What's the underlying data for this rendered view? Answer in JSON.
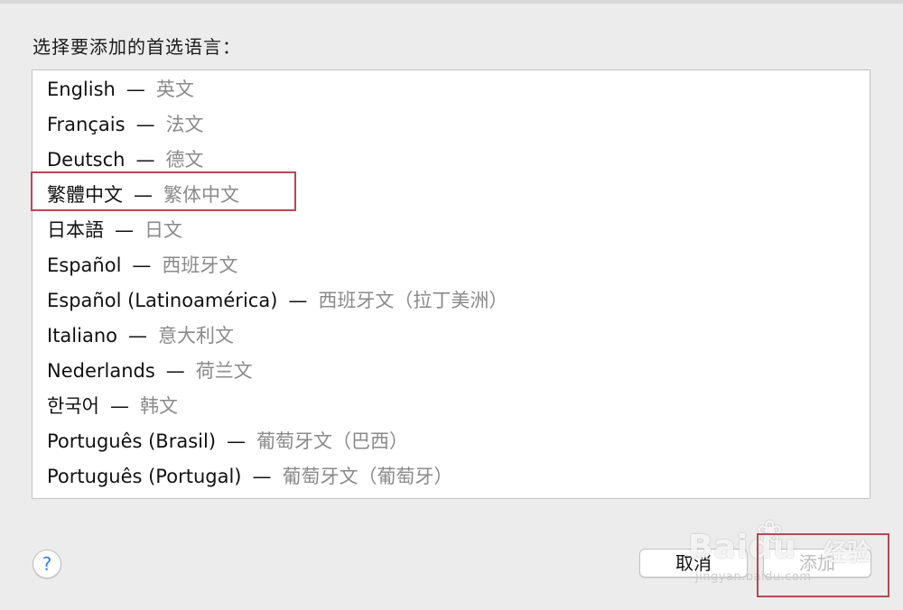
{
  "prompt": "选择要添加的首选语言：",
  "languages": [
    {
      "native": "English",
      "sep": "—",
      "translation": "英文"
    },
    {
      "native": "Français",
      "sep": "—",
      "translation": "法文"
    },
    {
      "native": "Deutsch",
      "sep": "—",
      "translation": "德文"
    },
    {
      "native": "繁體中文",
      "sep": "—",
      "translation": "繁体中文"
    },
    {
      "native": "日本語",
      "sep": "—",
      "translation": "日文"
    },
    {
      "native": "Español",
      "sep": "—",
      "translation": "西班牙文"
    },
    {
      "native": "Español (Latinoamérica)",
      "sep": "—",
      "translation": "西班牙文（拉丁美洲）"
    },
    {
      "native": "Italiano",
      "sep": "—",
      "translation": "意大利文"
    },
    {
      "native": "Nederlands",
      "sep": "—",
      "translation": "荷兰文"
    },
    {
      "native": "한국어",
      "sep": "—",
      "translation": "韩文"
    },
    {
      "native": "Português (Brasil)",
      "sep": "—",
      "translation": "葡萄牙文（巴西）"
    },
    {
      "native": "Português (Portugal)",
      "sep": "—",
      "translation": "葡萄牙文（葡萄牙）"
    }
  ],
  "help": {
    "label": "?",
    "icon": "question-mark-icon"
  },
  "buttons": {
    "cancel_label": "取消",
    "add_label": "添加"
  },
  "watermark": {
    "logo": "Baidu",
    "cn": "经验",
    "sub": "jingyan.baidu.com"
  },
  "colors": {
    "highlight": "#b04a56",
    "translation_text": "#8a8a8a",
    "help_accent": "#3a7be0"
  }
}
